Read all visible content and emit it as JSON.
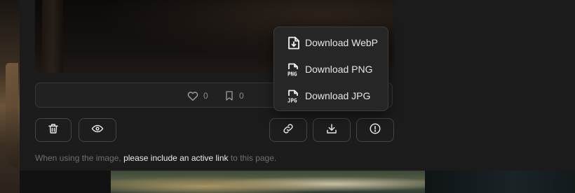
{
  "stats": {
    "likes": "0",
    "bookmarks": "0"
  },
  "actions": {
    "delete_icon": "trash-icon",
    "view_icon": "eye-icon",
    "link_icon": "link-icon",
    "download_icon": "download-icon",
    "report_icon": "alert-icon"
  },
  "download_menu": {
    "items": [
      {
        "label": "Download WebP",
        "icon": "file-download-icon"
      },
      {
        "label": "Download PNG",
        "icon": "png-file-icon",
        "badge": "PNG"
      },
      {
        "label": "Download JPG",
        "icon": "jpg-file-icon",
        "badge": "JPG"
      }
    ]
  },
  "note": {
    "prefix": "When using the image, ",
    "link_text": "please include an active link",
    "suffix": " to this page."
  },
  "colors": {
    "panel": "#1b1b1b",
    "border": "#454545",
    "text": "#e6e6e6",
    "muted": "#6f6f6f"
  }
}
